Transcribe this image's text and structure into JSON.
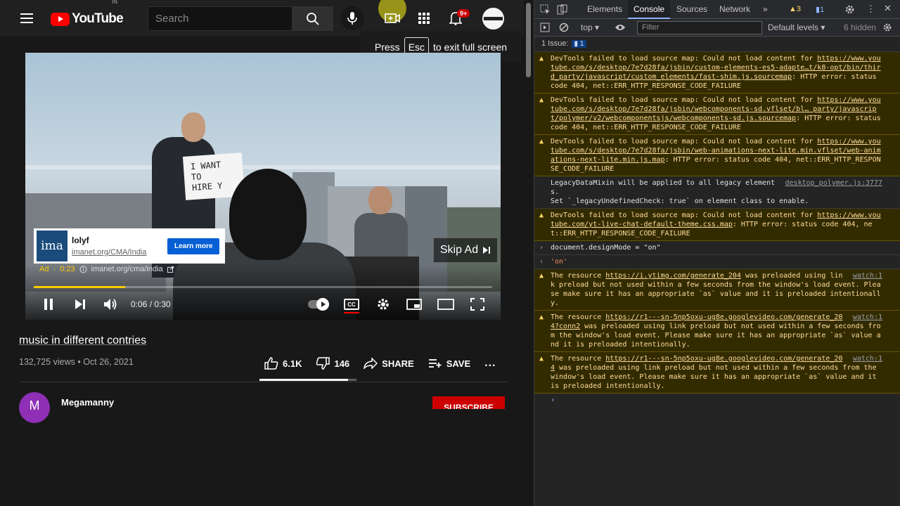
{
  "youtube": {
    "logo_text": "YouTube",
    "logo_region": "IN",
    "search_placeholder": "Search",
    "notification_count": "9+",
    "fullscreen_toast": {
      "press": "Press",
      "key": "Esc",
      "suffix": "to exit full screen"
    },
    "player": {
      "sign_text": "I WANT\nTO\nHIRE Y",
      "ad": {
        "logo_text": "ima",
        "title": "lolyf",
        "url": "imanet.org/CMA/India",
        "cta": "Learn more",
        "badge": "Ad",
        "countdown": "0:23",
        "link": "imanet.org/cma/india"
      },
      "skip_label": "Skip Ad",
      "time": "0:06 / 0:30",
      "progress": 0.2,
      "cc_label": "CC"
    },
    "video": {
      "title": "music in different contries",
      "views": "132,725 views",
      "date": "Oct 26, 2021",
      "likes": "6.1K",
      "dislikes": "146",
      "share_label": "SHARE",
      "save_label": "SAVE",
      "more_label": "..."
    },
    "channel": {
      "avatar_letter": "M",
      "name": "Megamanny",
      "subscribe_label": "SUBSCRIBE"
    }
  },
  "devtools": {
    "tabs": [
      "Elements",
      "Console",
      "Sources",
      "Network"
    ],
    "active_tab": "Console",
    "more_tabs": "»",
    "warning_count": "3",
    "message_count": "1",
    "toolbar": {
      "context": "top",
      "filter_placeholder": "Filter",
      "levels": "Default levels",
      "hidden": "6 hidden"
    },
    "issues": {
      "label": "1 Issue:",
      "count": "1"
    },
    "messages": [
      {
        "kind": "warn",
        "text": "DevTools failed to load source map: Could not load content for ",
        "link": "https://www.youtube.com/s/desktop/7e7d28fa/jsbin/custom-elements-es5-adapte…t/k8-opt/bin/third_party/javascript/custom_elements/fast-shim.js.sourcemap",
        "tail": ": HTTP error: status code 404, net::ERR_HTTP_RESPONSE_CODE_FAILURE"
      },
      {
        "kind": "warn",
        "text": "DevTools failed to load source map: Could not load content for ",
        "link": "https://www.youtube.com/s/desktop/7e7d28fa/jsbin/webcomponents-sd.vflset/bl… party/javascript/polymer/v2/webcomponentsjs/webcomponents-sd.js.sourcemap",
        "tail": ": HTTP error: status code 404, net::ERR_HTTP_RESPONSE_CODE_FAILURE"
      },
      {
        "kind": "warn",
        "text": "DevTools failed to load source map: Could not load content for ",
        "link": "https://www.youtube.com/s/desktop/7e7d28fa/jsbin/web-animations-next-lite.min.vflset/web-animations-next-lite.min.js.map",
        "tail": ": HTTP error: status code 404, net::ERR_HTTP_RESPONSE_CODE_FAILURE"
      },
      {
        "kind": "info",
        "text": "LegacyDataMixin will be applied to all legacy elements.\nSet `_legacyUndefinedCheck: true` on element class to enable.",
        "source": "desktop_polymer.js:3777"
      },
      {
        "kind": "warn",
        "text": "DevTools failed to load source map: Could not load content for ",
        "link": "https://www.youtube.com/yt-live-chat-default-theme.css.map",
        "tail": ": HTTP error: status code 404, net::ERR_HTTP_RESPONSE_CODE_FAILURE"
      },
      {
        "kind": "input",
        "text": "document.designMode = \"on\""
      },
      {
        "kind": "result",
        "text": "'on'"
      },
      {
        "kind": "warn",
        "text": "The resource ",
        "link": "https://i.ytimg.com/generate_204",
        "tail": " was preloaded using link preload but not used within a few seconds from the window's load event. Please make sure it has an appropriate `as` value and it is preloaded intentionally.",
        "source": "watch:1"
      },
      {
        "kind": "warn",
        "text": "The resource ",
        "link": "https://r1---sn-5np5oxu-ug8e.googlevideo.com/generate_204?conn2",
        "tail": " was preloaded using link preload but not used within a few seconds from the window's load event. Please make sure it has an appropriate `as` value and it is preloaded intentionally.",
        "source": "watch:1"
      },
      {
        "kind": "warn",
        "text": "The resource ",
        "link": "https://r1---sn-5np5oxu-ug8e.googlevideo.com/generate_204",
        "tail": " was preloaded using link preload but not used within a few seconds from the window's load event. Please make sure it has an appropriate `as` value and it is preloaded intentionally.",
        "source": "watch:1"
      }
    ],
    "prompt": "›"
  },
  "colors": {
    "yt_red": "#ff0000",
    "ad_yellow": "#ffcc00",
    "warn_bg": "#332b00",
    "warn_text": "#ffdd9e",
    "devtools_accent": "#8ab4f8"
  }
}
